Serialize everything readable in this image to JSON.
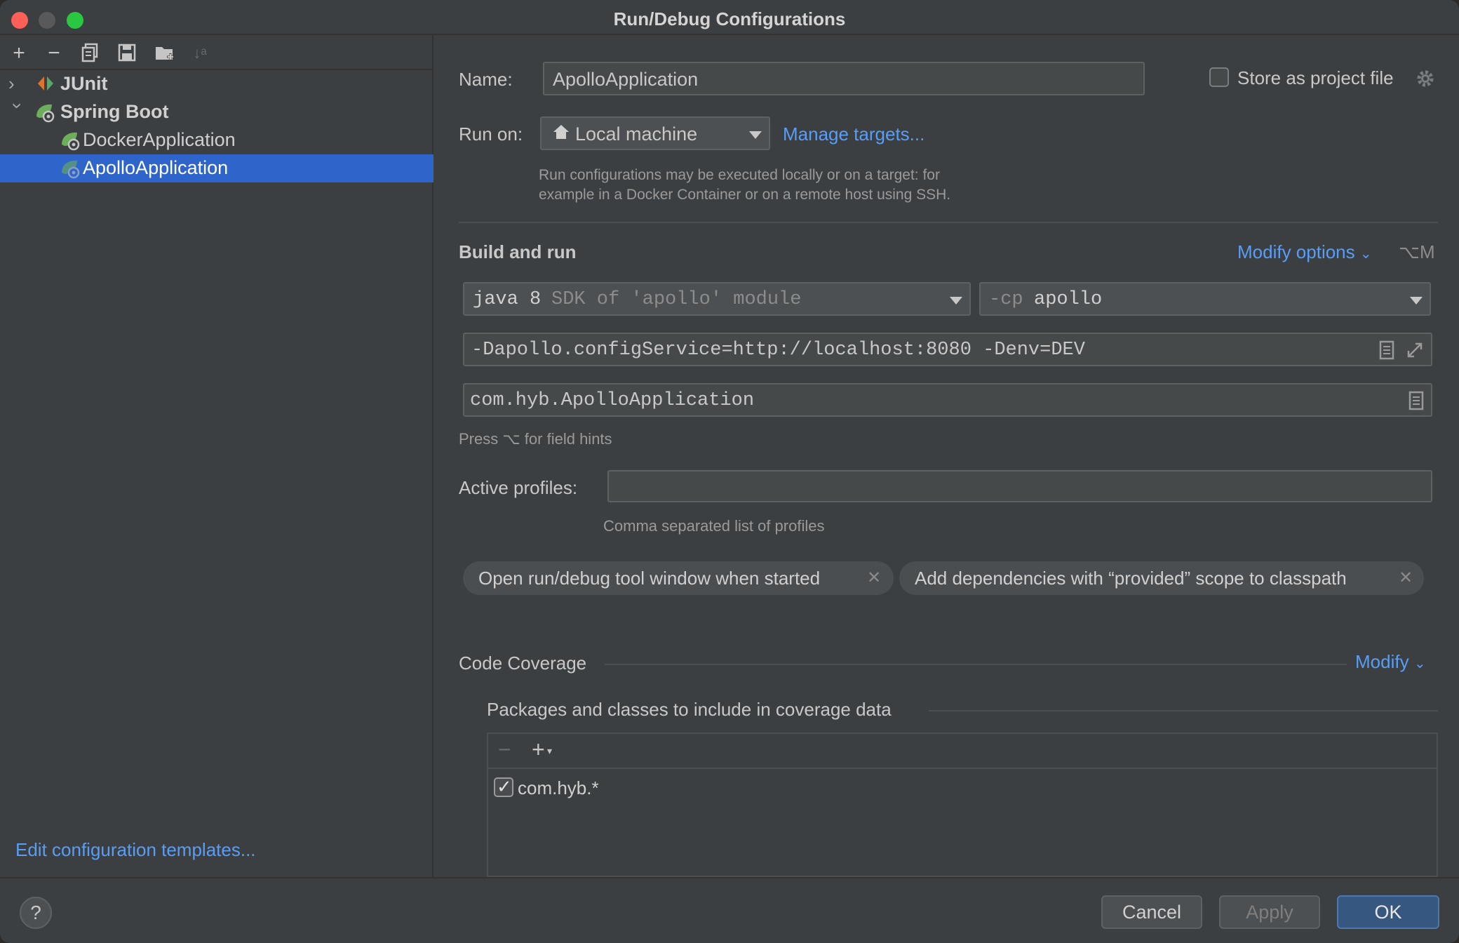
{
  "window": {
    "title": "Run/Debug Configurations"
  },
  "tree": {
    "items": [
      {
        "label": "JUnit",
        "expanded": false
      },
      {
        "label": "Spring Boot",
        "expanded": true
      },
      {
        "label": "DockerApplication"
      },
      {
        "label": "ApolloApplication",
        "selected": true
      }
    ],
    "edit_templates_link": "Edit configuration templates..."
  },
  "form": {
    "name_label": "Name:",
    "name_value": "ApolloApplication",
    "store_label": "Store as project file",
    "store_checked": false,
    "run_on_label": "Run on:",
    "run_on_value": "Local machine",
    "manage_targets_link": "Manage targets...",
    "run_on_hint_1": "Run configurations may be executed locally or on a target: for",
    "run_on_hint_2": "example in a Docker Container or on a remote host using SSH.",
    "build_run_heading": "Build and run",
    "modify_options_link": "Modify options",
    "modify_options_shortcut": "⌥M",
    "jre_main": "java 8",
    "jre_detail": "SDK of 'apollo' module",
    "cp_flag": "-cp",
    "cp_value": "apollo",
    "vm_options": "-Dapollo.configService=http://localhost:8080 -Denv=DEV",
    "main_class": "com.hyb.ApolloApplication",
    "field_hints": "Press ⌥ for field hints",
    "active_profiles_label": "Active profiles:",
    "active_profiles_value": "",
    "active_profiles_hint": "Comma separated list of profiles",
    "chips": [
      "Open run/debug tool window when started",
      "Add dependencies with “provided” scope to classpath"
    ],
    "code_coverage_heading": "Code Coverage",
    "modify_link": "Modify",
    "packages_heading": "Packages and classes to include in coverage data",
    "coverage_patterns": [
      {
        "pattern": "com.hyb.*",
        "checked": true
      }
    ]
  },
  "footer": {
    "help_label": "?",
    "cancel_label": "Cancel",
    "apply_label": "Apply",
    "ok_label": "OK"
  },
  "colors": {
    "accent": "#2f65ca",
    "link": "#589df6",
    "background": "#3c3f41"
  }
}
